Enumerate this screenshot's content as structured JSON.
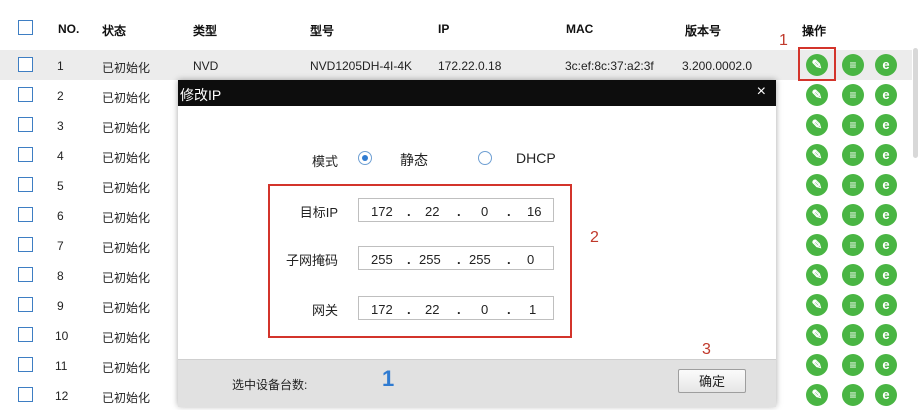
{
  "table": {
    "headers": {
      "no": "NO.",
      "status": "状态",
      "type": "类型",
      "model": "型号",
      "ip": "IP",
      "mac": "MAC",
      "version": "版本号",
      "ops": "操作"
    },
    "rows": [
      {
        "no": "1",
        "status": "已初始化",
        "type": "NVD",
        "model": "NVD1205DH-4I-4K",
        "ip": "172.22.0.18",
        "mac": "3c:ef:8c:37:a2:3f",
        "version": "3.200.0002.0"
      },
      {
        "no": "2",
        "status": "已初始化"
      },
      {
        "no": "3",
        "status": "已初始化"
      },
      {
        "no": "4",
        "status": "已初始化"
      },
      {
        "no": "5",
        "status": "已初始化"
      },
      {
        "no": "6",
        "status": "已初始化"
      },
      {
        "no": "7",
        "status": "已初始化"
      },
      {
        "no": "8",
        "status": "已初始化"
      },
      {
        "no": "9",
        "status": "已初始化"
      },
      {
        "no": "10",
        "status": "已初始化"
      },
      {
        "no": "11",
        "status": "已初始化"
      },
      {
        "no": "12",
        "status": "已初始化"
      }
    ],
    "icons": {
      "edit": "pencil-icon",
      "doc": "document-icon",
      "web": "browser-e-icon"
    },
    "accent_color": "#49b543"
  },
  "annotations": {
    "one": "1",
    "two": "2",
    "three": "3"
  },
  "dialog": {
    "title": "修改IP",
    "close": "×",
    "mode_label": "模式",
    "mode_static": "静态",
    "mode_dhcp": "DHCP",
    "selected_mode": "静态",
    "ip_label": "目标IP",
    "ip": [
      "172",
      "22",
      "0",
      "16"
    ],
    "mask_label": "子网掩码",
    "mask": [
      "255",
      "255",
      "255",
      "0"
    ],
    "gateway_label": "网关",
    "gateway": [
      "172",
      "22",
      "0",
      "1"
    ],
    "footer_label": "选中设备台数:",
    "selected_count": "1",
    "ok": "确定"
  }
}
